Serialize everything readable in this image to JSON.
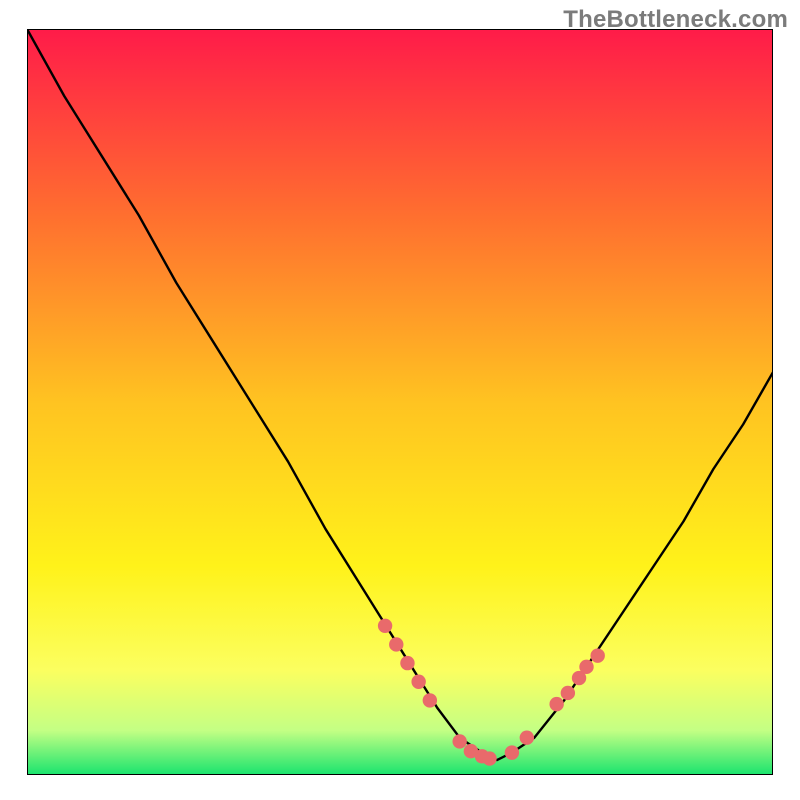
{
  "watermark": "TheBottleneck.com",
  "chart_data": {
    "type": "line",
    "title": "",
    "xlabel": "",
    "ylabel": "",
    "xlim": [
      0,
      100
    ],
    "ylim": [
      0,
      100
    ],
    "grid": false,
    "legend": false,
    "background_gradient": {
      "stops": [
        {
          "offset": 0.0,
          "color": "#ff1b49"
        },
        {
          "offset": 0.25,
          "color": "#ff6f2f"
        },
        {
          "offset": 0.5,
          "color": "#ffc321"
        },
        {
          "offset": 0.72,
          "color": "#fff21a"
        },
        {
          "offset": 0.86,
          "color": "#fbff60"
        },
        {
          "offset": 0.94,
          "color": "#c4ff84"
        },
        {
          "offset": 1.0,
          "color": "#19e46e"
        }
      ]
    },
    "series": [
      {
        "name": "bottleneck-curve",
        "color": "#000000",
        "x": [
          0,
          5,
          10,
          15,
          20,
          25,
          30,
          35,
          40,
          45,
          50,
          55,
          58,
          61,
          63,
          65,
          68,
          72,
          76,
          80,
          84,
          88,
          92,
          96,
          100
        ],
        "y": [
          100,
          91,
          83,
          75,
          66,
          58,
          50,
          42,
          33,
          25,
          17,
          9,
          5,
          3,
          2,
          3,
          5,
          10,
          16,
          22,
          28,
          34,
          41,
          47,
          54
        ]
      }
    ],
    "marker_points": {
      "name": "selected-points",
      "color": "#e96a6b",
      "radius": 7.2,
      "x": [
        48,
        49.5,
        51,
        52.5,
        54,
        58,
        59.5,
        61,
        62,
        65,
        67,
        71,
        72.5,
        74,
        75,
        76.5
      ],
      "y": [
        20,
        17.5,
        15,
        12.5,
        10,
        4.5,
        3.2,
        2.5,
        2.2,
        3,
        5,
        9.5,
        11,
        13,
        14.5,
        16
      ]
    }
  }
}
